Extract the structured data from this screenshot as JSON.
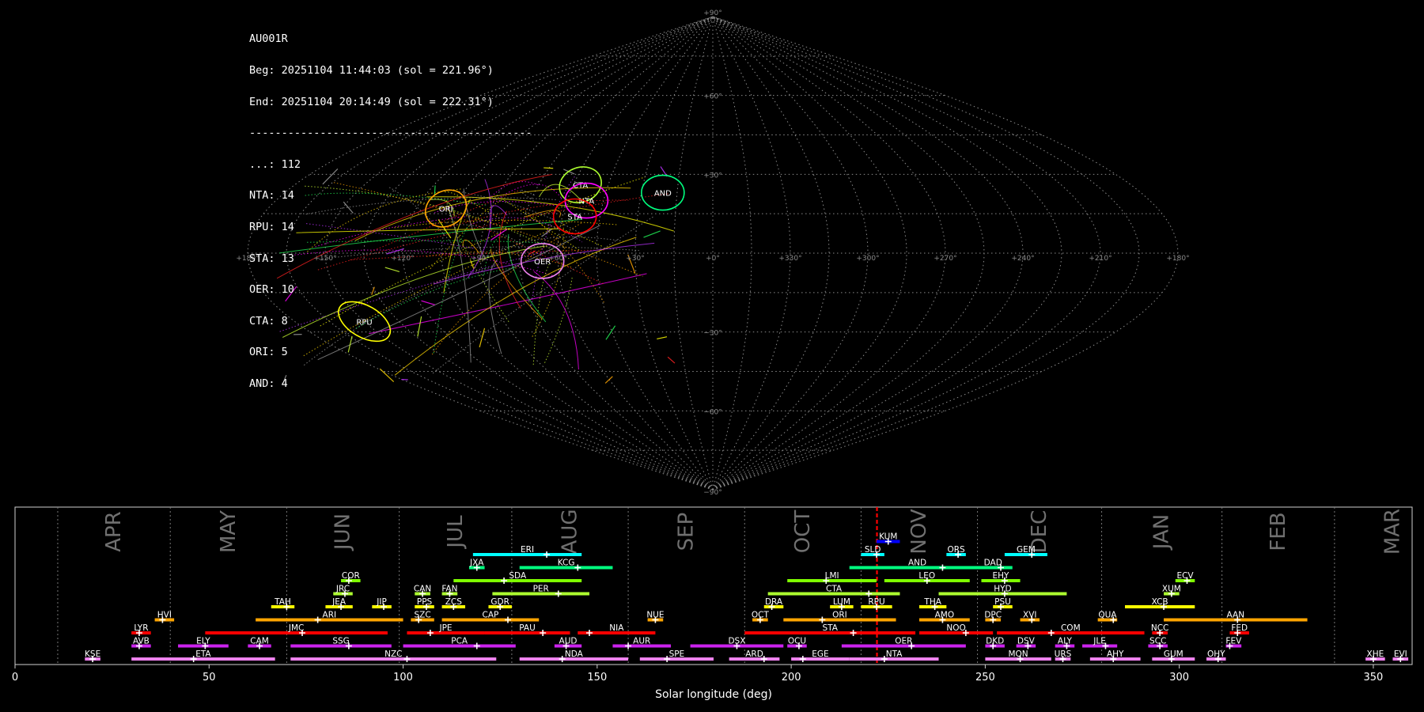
{
  "info": {
    "station": "AU001R",
    "begin": "Beg: 20251104 11:44:03 (sol = 221.96°)",
    "end": "End: 20251104 20:14:49 (sol = 222.31°)",
    "separator": "--------------------------------------------",
    "counts": [
      "...: 112",
      "NTA: 14",
      "RPU: 14",
      "STA: 13",
      "OER: 10",
      "CTA: 8",
      "ORI: 5",
      "AND: 4"
    ]
  },
  "sky_map": {
    "projection": "sinusoidal",
    "lat_ticks": [
      {
        "lat": 90,
        "label": "+90°"
      },
      {
        "lat": 60,
        "label": "+60°"
      },
      {
        "lat": 30,
        "label": "+30°"
      },
      {
        "lat": -30,
        "label": "−30°"
      },
      {
        "lat": -60,
        "label": "−60°"
      },
      {
        "lat": -90,
        "label": "−90°"
      }
    ],
    "lon_ticks": [
      "+180°",
      "+150°",
      "+120°",
      "+90°",
      "+60°",
      "+30°",
      "+0°",
      "+330°",
      "+300°",
      "+270°",
      "+240°",
      "+210°",
      "+180°"
    ],
    "radiants": [
      {
        "name": "ORI",
        "lon": 108,
        "lat": 17,
        "color": "#ffa500"
      },
      {
        "name": "CTA",
        "lon": 57,
        "lat": 26,
        "color": "#adff2f"
      },
      {
        "name": "NTA",
        "lon": 52,
        "lat": 20,
        "color": "#ff00ff"
      },
      {
        "name": "STA",
        "lon": 55,
        "lat": 14,
        "color": "#ff0000"
      },
      {
        "name": "AND",
        "lon": 21,
        "lat": 23,
        "color": "#00ff7f"
      },
      {
        "name": "OER",
        "lon": 66,
        "lat": -3,
        "color": "#ee82ee"
      },
      {
        "name": "RPU",
        "lon": 150,
        "lat": -26,
        "color": "#ffff00"
      }
    ]
  },
  "chart_data": {
    "type": "timeline",
    "xlabel": "Solar longitude (deg)",
    "xlim": [
      0,
      360
    ],
    "x_ticks": [
      0,
      50,
      100,
      150,
      200,
      250,
      300,
      350
    ],
    "current_sol": 222.1,
    "months": [
      {
        "name": "APR",
        "start": 11
      },
      {
        "name": "MAY",
        "start": 40
      },
      {
        "name": "JUN",
        "start": 70
      },
      {
        "name": "JUL",
        "start": 99
      },
      {
        "name": "AUG",
        "start": 128
      },
      {
        "name": "SEP",
        "start": 158
      },
      {
        "name": "OCT",
        "start": 188
      },
      {
        "name": "NOV",
        "start": 218
      },
      {
        "name": "DEC",
        "start": 248
      },
      {
        "name": "JAN",
        "start": 280
      },
      {
        "name": "FEB",
        "start": 311
      },
      {
        "name": "MAR",
        "start": 340
      }
    ],
    "showers": [
      {
        "code": "KUM",
        "start": 222,
        "end": 228,
        "peak": 225,
        "row": 9,
        "color": "#0000ff"
      },
      {
        "code": "ERI",
        "start": 118,
        "end": 146,
        "peak": 137,
        "row": 8,
        "color": "#00ffff"
      },
      {
        "code": "SLD",
        "start": 218,
        "end": 224,
        "peak": 222,
        "row": 8,
        "color": "#00ffff"
      },
      {
        "code": "ORS",
        "start": 240,
        "end": 245,
        "peak": 243,
        "row": 8,
        "color": "#00ffff"
      },
      {
        "code": "GEM",
        "start": 255,
        "end": 266,
        "peak": 262,
        "row": 8,
        "color": "#00ffff"
      },
      {
        "code": "JXA",
        "start": 117,
        "end": 121,
        "peak": 119,
        "row": 7,
        "color": "#00ff7f"
      },
      {
        "code": "KCG",
        "start": 130,
        "end": 154,
        "peak": 145,
        "row": 7,
        "color": "#00ff7f"
      },
      {
        "code": "AND",
        "start": 215,
        "end": 250,
        "peak": 239,
        "row": 7,
        "color": "#00ff7f"
      },
      {
        "code": "DAD",
        "start": 247,
        "end": 257,
        "peak": 254,
        "row": 7,
        "color": "#00ff7f"
      },
      {
        "code": "COR",
        "start": 84,
        "end": 89,
        "peak": 86,
        "row": 6,
        "color": "#7fff00"
      },
      {
        "code": "SDA",
        "start": 113,
        "end": 146,
        "peak": 126,
        "row": 6,
        "color": "#7fff00"
      },
      {
        "code": "LMI",
        "start": 199,
        "end": 222,
        "peak": 209,
        "row": 6,
        "color": "#7fff00"
      },
      {
        "code": "LEO",
        "start": 224,
        "end": 246,
        "peak": 235,
        "row": 6,
        "color": "#7fff00"
      },
      {
        "code": "EHY",
        "start": 249,
        "end": 259,
        "peak": 255,
        "row": 6,
        "color": "#7fff00"
      },
      {
        "code": "ECV",
        "start": 299,
        "end": 304,
        "peak": 302,
        "row": 6,
        "color": "#7fff00"
      },
      {
        "code": "JRC",
        "start": 82,
        "end": 87,
        "peak": 85,
        "row": 5,
        "color": "#adff2f"
      },
      {
        "code": "CAN",
        "start": 103,
        "end": 107,
        "peak": 105,
        "row": 5,
        "color": "#adff2f"
      },
      {
        "code": "FAN",
        "start": 110,
        "end": 114,
        "peak": 112,
        "row": 5,
        "color": "#adff2f"
      },
      {
        "code": "PER",
        "start": 123,
        "end": 148,
        "peak": 140,
        "row": 5,
        "color": "#adff2f"
      },
      {
        "code": "CTA",
        "start": 194,
        "end": 228,
        "peak": 220,
        "row": 5,
        "color": "#adff2f"
      },
      {
        "code": "HYD",
        "start": 238,
        "end": 271,
        "peak": 255,
        "row": 5,
        "color": "#adff2f"
      },
      {
        "code": "XUM",
        "start": 296,
        "end": 300,
        "peak": 298,
        "row": 5,
        "color": "#adff2f"
      },
      {
        "code": "TAH",
        "start": 66,
        "end": 72,
        "peak": 70,
        "row": 4,
        "color": "#ffff00"
      },
      {
        "code": "JEA",
        "start": 80,
        "end": 87,
        "peak": 84,
        "row": 4,
        "color": "#ffff00"
      },
      {
        "code": "JIP",
        "start": 92,
        "end": 97,
        "peak": 95,
        "row": 4,
        "color": "#ffff00"
      },
      {
        "code": "PPS",
        "start": 103,
        "end": 108,
        "peak": 106,
        "row": 4,
        "color": "#ffff00"
      },
      {
        "code": "ZCS",
        "start": 110,
        "end": 116,
        "peak": 113,
        "row": 4,
        "color": "#ffff00"
      },
      {
        "code": "GDR",
        "start": 122,
        "end": 128,
        "peak": 125,
        "row": 4,
        "color": "#ffff00"
      },
      {
        "code": "DRA",
        "start": 193,
        "end": 198,
        "peak": 195,
        "row": 4,
        "color": "#ffff00"
      },
      {
        "code": "LUM",
        "start": 210,
        "end": 216,
        "peak": 213,
        "row": 4,
        "color": "#ffff00"
      },
      {
        "code": "RPU",
        "start": 218,
        "end": 226,
        "peak": 222,
        "row": 4,
        "color": "#ffff00"
      },
      {
        "code": "THA",
        "start": 233,
        "end": 240,
        "peak": 237,
        "row": 4,
        "color": "#ffff00"
      },
      {
        "code": "PSU",
        "start": 252,
        "end": 257,
        "peak": 254,
        "row": 4,
        "color": "#ffff00"
      },
      {
        "code": "XCB",
        "start": 286,
        "end": 304,
        "peak": 296,
        "row": 4,
        "color": "#ffff00"
      },
      {
        "code": "HVI",
        "start": 36,
        "end": 41,
        "peak": 38,
        "row": 3,
        "color": "#ffa500"
      },
      {
        "code": "ARI",
        "start": 62,
        "end": 100,
        "peak": 78,
        "row": 3,
        "color": "#ffa500"
      },
      {
        "code": "SZC",
        "start": 102,
        "end": 108,
        "peak": 104,
        "row": 3,
        "color": "#ffa500"
      },
      {
        "code": "CAP",
        "start": 110,
        "end": 135,
        "peak": 127,
        "row": 3,
        "color": "#ffa500"
      },
      {
        "code": "NUE",
        "start": 163,
        "end": 167,
        "peak": 165,
        "row": 3,
        "color": "#ffa500"
      },
      {
        "code": "OCT",
        "start": 190,
        "end": 194,
        "peak": 192,
        "row": 3,
        "color": "#ffa500"
      },
      {
        "code": "ORI",
        "start": 198,
        "end": 227,
        "peak": 208,
        "row": 3,
        "color": "#ffa500"
      },
      {
        "code": "AMO",
        "start": 233,
        "end": 246,
        "peak": 239,
        "row": 3,
        "color": "#ffa500"
      },
      {
        "code": "DPC",
        "start": 250,
        "end": 254,
        "peak": 252,
        "row": 3,
        "color": "#ffa500"
      },
      {
        "code": "XVI",
        "start": 259,
        "end": 264,
        "peak": 262,
        "row": 3,
        "color": "#ffa500"
      },
      {
        "code": "QUA",
        "start": 279,
        "end": 284,
        "peak": 283,
        "row": 3,
        "color": "#ffa500"
      },
      {
        "code": "AAN",
        "start": 296,
        "end": 333,
        "peak": 315,
        "row": 3,
        "color": "#ffa500"
      },
      {
        "code": "LYR",
        "start": 30,
        "end": 35,
        "peak": 32,
        "row": 2,
        "color": "#ff0000"
      },
      {
        "code": "JMC",
        "start": 49,
        "end": 96,
        "peak": 74,
        "row": 2,
        "color": "#ff0000"
      },
      {
        "code": "JPE",
        "start": 101,
        "end": 121,
        "peak": 107,
        "row": 2,
        "color": "#ff0000"
      },
      {
        "code": "PAU",
        "start": 121,
        "end": 143,
        "peak": 136,
        "row": 2,
        "color": "#ff0000"
      },
      {
        "code": "NIA",
        "start": 145,
        "end": 165,
        "peak": 148,
        "row": 2,
        "color": "#ff0000"
      },
      {
        "code": "STA",
        "start": 188,
        "end": 232,
        "peak": 216,
        "row": 2,
        "color": "#ff0000"
      },
      {
        "code": "NOO",
        "start": 233,
        "end": 252,
        "peak": 245,
        "row": 2,
        "color": "#ff0000"
      },
      {
        "code": "COM",
        "start": 253,
        "end": 291,
        "peak": 267,
        "row": 2,
        "color": "#ff0000"
      },
      {
        "code": "NCC",
        "start": 293,
        "end": 297,
        "peak": 295,
        "row": 2,
        "color": "#ff0000"
      },
      {
        "code": "FED",
        "start": 313,
        "end": 318,
        "peak": 315,
        "row": 2,
        "color": "#ff0000"
      },
      {
        "code": "AVB",
        "start": 30,
        "end": 35,
        "peak": 32,
        "row": 1,
        "color": "#cc22ee"
      },
      {
        "code": "ELY",
        "start": 42,
        "end": 55,
        "peak": 49,
        "row": 1,
        "color": "#cc22ee"
      },
      {
        "code": "CAM",
        "start": 60,
        "end": 66,
        "peak": 63,
        "row": 1,
        "color": "#cc22ee"
      },
      {
        "code": "SSG",
        "start": 71,
        "end": 97,
        "peak": 86,
        "row": 1,
        "color": "#cc22ee"
      },
      {
        "code": "PCA",
        "start": 100,
        "end": 129,
        "peak": 119,
        "row": 1,
        "color": "#cc22ee"
      },
      {
        "code": "AUD",
        "start": 139,
        "end": 146,
        "peak": 142,
        "row": 1,
        "color": "#cc22ee"
      },
      {
        "code": "AUR",
        "start": 154,
        "end": 169,
        "peak": 158,
        "row": 1,
        "color": "#cc22ee"
      },
      {
        "code": "DSX",
        "start": 174,
        "end": 198,
        "peak": 186,
        "row": 1,
        "color": "#cc22ee"
      },
      {
        "code": "OCU",
        "start": 199,
        "end": 204,
        "peak": 202,
        "row": 1,
        "color": "#cc22ee"
      },
      {
        "code": "OER",
        "start": 213,
        "end": 245,
        "peak": 231,
        "row": 1,
        "color": "#cc22ee"
      },
      {
        "code": "DKD",
        "start": 250,
        "end": 255,
        "peak": 252,
        "row": 1,
        "color": "#cc22ee"
      },
      {
        "code": "DSV",
        "start": 258,
        "end": 263,
        "peak": 261,
        "row": 1,
        "color": "#cc22ee"
      },
      {
        "code": "ALY",
        "start": 268,
        "end": 273,
        "peak": 271,
        "row": 1,
        "color": "#cc22ee"
      },
      {
        "code": "JLE",
        "start": 275,
        "end": 284,
        "peak": 281,
        "row": 1,
        "color": "#cc22ee"
      },
      {
        "code": "SCC",
        "start": 292,
        "end": 297,
        "peak": 295,
        "row": 1,
        "color": "#cc22ee"
      },
      {
        "code": "FEV",
        "start": 312,
        "end": 316,
        "peak": 313,
        "row": 1,
        "color": "#cc22ee"
      },
      {
        "code": "KSE",
        "start": 18,
        "end": 22,
        "peak": 20,
        "row": 0,
        "color": "#ee82ee"
      },
      {
        "code": "ETA",
        "start": 30,
        "end": 67,
        "peak": 46,
        "row": 0,
        "color": "#ee82ee"
      },
      {
        "code": "NZC",
        "start": 71,
        "end": 124,
        "peak": 101,
        "row": 0,
        "color": "#ee82ee"
      },
      {
        "code": "NDA",
        "start": 130,
        "end": 158,
        "peak": 141,
        "row": 0,
        "color": "#ee82ee"
      },
      {
        "code": "SPE",
        "start": 161,
        "end": 180,
        "peak": 168,
        "row": 0,
        "color": "#ee82ee"
      },
      {
        "code": "ARD",
        "start": 184,
        "end": 197,
        "peak": 193,
        "row": 0,
        "color": "#ee82ee"
      },
      {
        "code": "EGE",
        "start": 200,
        "end": 215,
        "peak": 203,
        "row": 0,
        "color": "#ee82ee"
      },
      {
        "code": "NTA",
        "start": 215,
        "end": 238,
        "peak": 224,
        "row": 0,
        "color": "#ee82ee"
      },
      {
        "code": "MON",
        "start": 250,
        "end": 267,
        "peak": 259,
        "row": 0,
        "color": "#ee82ee"
      },
      {
        "code": "URS",
        "start": 268,
        "end": 272,
        "peak": 270,
        "row": 0,
        "color": "#ee82ee"
      },
      {
        "code": "AHY",
        "start": 277,
        "end": 290,
        "peak": 283,
        "row": 0,
        "color": "#ee82ee"
      },
      {
        "code": "GUM",
        "start": 293,
        "end": 304,
        "peak": 298,
        "row": 0,
        "color": "#ee82ee"
      },
      {
        "code": "OHY",
        "start": 307,
        "end": 312,
        "peak": 310,
        "row": 0,
        "color": "#ee82ee"
      },
      {
        "code": "XHE",
        "start": 348,
        "end": 353,
        "peak": 350,
        "row": 0,
        "color": "#ee82ee"
      },
      {
        "code": "EVI",
        "start": 355,
        "end": 359,
        "peak": 357,
        "row": 0,
        "color": "#ee82ee"
      }
    ]
  }
}
